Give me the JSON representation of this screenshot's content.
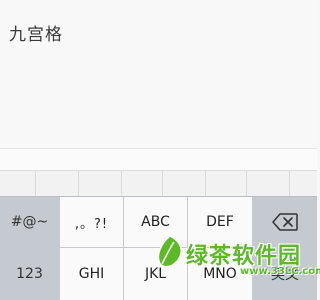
{
  "text_area": {
    "content": "九宫格"
  },
  "keyboard": {
    "row1": [
      {
        "label": "#@~",
        "type": "func"
      },
      {
        "label": ",。?!",
        "type": "symbol"
      },
      {
        "label": "ABC",
        "type": "char"
      },
      {
        "label": "DEF",
        "type": "char"
      },
      {
        "label": "",
        "type": "backspace",
        "icon": "backspace-icon"
      }
    ],
    "row2": [
      {
        "label": "123",
        "type": "func"
      },
      {
        "label": "GHI",
        "type": "char"
      },
      {
        "label": "JKL",
        "type": "char"
      },
      {
        "label": "MNO",
        "type": "char"
      },
      {
        "label": "英文",
        "type": "func"
      }
    ]
  },
  "watermark": {
    "text": "绿茶软件园",
    "url": "www.33LC.com"
  },
  "colors": {
    "watermark": "#5fb82a",
    "function_key": "#c5cad0",
    "char_key": "#fafafa"
  }
}
